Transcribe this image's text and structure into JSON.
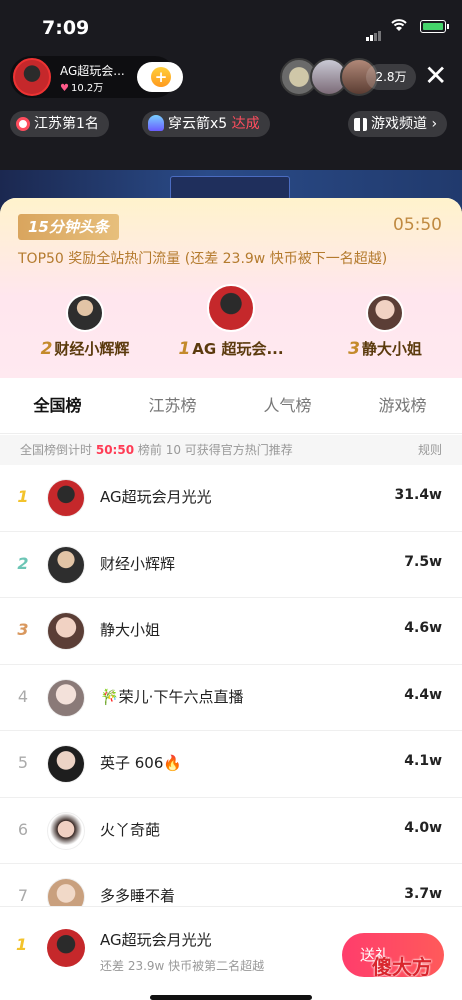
{
  "status_bar": {
    "time": "7:09"
  },
  "host": {
    "name": "AG超玩会...",
    "likes": "10.2万"
  },
  "viewers": {
    "count": "2.8万"
  },
  "tags": {
    "province": "江苏第1名",
    "rocket": "穿云箭x5",
    "rocket_status": "达成",
    "channel": "游戏频道"
  },
  "banner": {
    "badge": "15分钟头条",
    "countdown": "05:50",
    "reward_text": "TOP50 奖励全站热门流量 (还差 23.9w 快币被下一名超越)",
    "podium": [
      {
        "rank": "2",
        "name": "财经小辉辉"
      },
      {
        "rank": "1",
        "name": "AG 超玩会..."
      },
      {
        "rank": "3",
        "name": "静大小姐"
      }
    ]
  },
  "tabs": [
    "全国榜",
    "江苏榜",
    "人气榜",
    "游戏榜"
  ],
  "notice": {
    "prefix": "全国榜倒计时",
    "countdown": "50:50",
    "suffix": "榜前 10 可获得官方热门推荐",
    "rule": "规则"
  },
  "ranking": [
    {
      "rank": "1",
      "name": "AG超玩会月光光",
      "score": "31.4w"
    },
    {
      "rank": "2",
      "name": "财经小辉辉",
      "score": "7.5w"
    },
    {
      "rank": "3",
      "name": "静大小姐",
      "score": "4.6w"
    },
    {
      "rank": "4",
      "name": "🎋荣儿·下午六点直播",
      "score": "4.4w"
    },
    {
      "rank": "5",
      "name": "英子 606🔥",
      "score": "4.1w"
    },
    {
      "rank": "6",
      "name": "火丫奇葩",
      "score": "4.0w"
    },
    {
      "rank": "7",
      "name": "多多睡不着",
      "score": "3.7w"
    }
  ],
  "my_rank": {
    "rank": "1",
    "name": "AG超玩会月光光",
    "subtitle": "还差 23.9w 快币被第二名超越",
    "button": "送礼"
  },
  "watermark": "傻大方"
}
